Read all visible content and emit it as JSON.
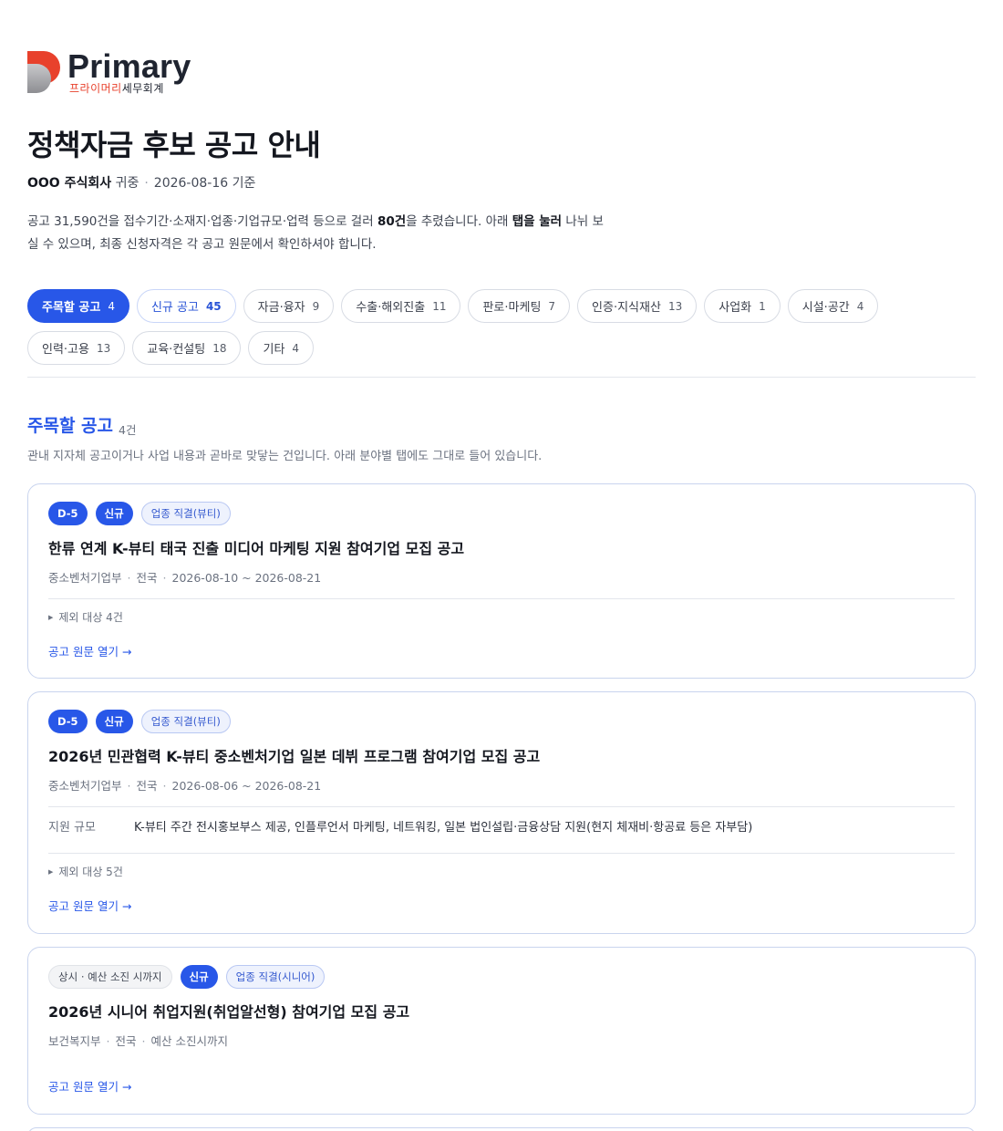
{
  "logo": {
    "word": "Primary",
    "sub_red": "프라이머리",
    "sub_dark": "세무회계"
  },
  "header": {
    "title": "정책자금 후보 공고 안내",
    "company": "OOO 주식회사",
    "honorific": "귀중",
    "date": "2026-08-16 기준"
  },
  "intro": {
    "p1": "공고 31,590건을 접수기간·소재지·업종·기업규모·업력 등으로 걸러 ",
    "b1": "80건",
    "p2": "을 추렸습니다. 아래 ",
    "b2": "탭을 눌러",
    "p3": " 나뉘 보실 수 있으며, 최종 신청자격은 각 공고 원문에서 확인하셔야 합니다."
  },
  "tabs": [
    {
      "label": "주목할 공고",
      "count": "4",
      "state": "active"
    },
    {
      "label": "신규 공고",
      "count": "45",
      "state": "new"
    },
    {
      "label": "자금·융자",
      "count": "9",
      "state": ""
    },
    {
      "label": "수출·해외진출",
      "count": "11",
      "state": ""
    },
    {
      "label": "판로·마케팅",
      "count": "7",
      "state": ""
    },
    {
      "label": "인증·지식재산",
      "count": "13",
      "state": ""
    },
    {
      "label": "사업화",
      "count": "1",
      "state": ""
    },
    {
      "label": "시설·공간",
      "count": "4",
      "state": ""
    },
    {
      "label": "인력·고용",
      "count": "13",
      "state": ""
    },
    {
      "label": "교육·컨설팅",
      "count": "18",
      "state": ""
    },
    {
      "label": "기타",
      "count": "4",
      "state": ""
    }
  ],
  "section": {
    "title": "주목할 공고",
    "count": "4건",
    "desc": "관내 지자체 공고이거나 사업 내용과 곧바로 맞닿는 건입니다. 아래 분야별 탭에도 그대로 들어 있습니다."
  },
  "cards": [
    {
      "badges": [
        {
          "text": "D-5",
          "style": "solid"
        },
        {
          "text": "신규",
          "style": "solid"
        },
        {
          "text": "업종 직결(뷰티)",
          "style": "outline"
        }
      ],
      "title": "한류 연계 K-뷰티 태국 진출 미디어 마케팅 지원 참여기업 모집 공고",
      "agency": "중소벤처기업부",
      "region": "전국",
      "period": "2026-08-10 ~ 2026-08-21",
      "support_label": "",
      "support_value": "",
      "exclude": "제외 대상 4건",
      "link": "공고 원문 열기 →"
    },
    {
      "badges": [
        {
          "text": "D-5",
          "style": "solid"
        },
        {
          "text": "신규",
          "style": "solid"
        },
        {
          "text": "업종 직결(뷰티)",
          "style": "outline"
        }
      ],
      "title": "2026년 민관협력 K-뷰티 중소벤처기업 일본 데뷔 프로그램 참여기업 모집 공고",
      "agency": "중소벤처기업부",
      "region": "전국",
      "period": "2026-08-06 ~ 2026-08-21",
      "support_label": "지원 규모",
      "support_value": "K-뷰티 주간 전시홍보부스 제공, 인플루언서 마케팅, 네트워킹, 일본 법인설립·금융상담 지원(현지 체재비·항공료 등은 자부담)",
      "exclude": "제외 대상 5건",
      "link": "공고 원문 열기 →"
    },
    {
      "badges": [
        {
          "text": "상시 · 예산 소진 시까지",
          "style": "gray"
        },
        {
          "text": "신규",
          "style": "solid"
        },
        {
          "text": "업종 직결(시니어)",
          "style": "outline"
        }
      ],
      "title": "2026년 시니어 취업지원(취업알선형) 참여기업 모집 공고",
      "agency": "보건복지부",
      "region": "전국",
      "period": "예산 소진시까지",
      "support_label": "",
      "support_value": "",
      "exclude": "",
      "link": "공고 원문 열기 →"
    }
  ]
}
